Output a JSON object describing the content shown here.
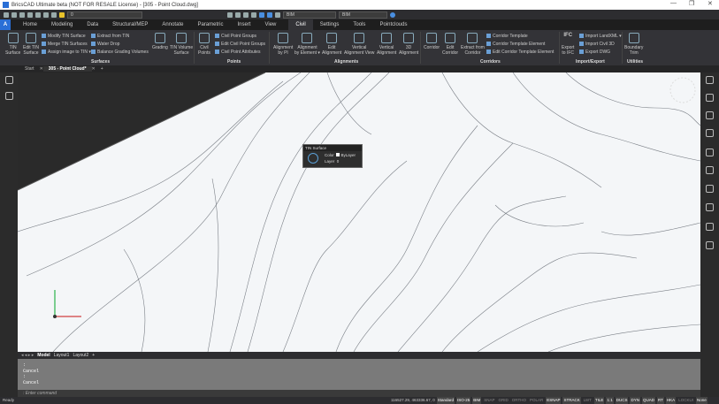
{
  "window": {
    "title": "BricsCAD Ultimate beta (NOT FOR RESALE License) - [305 - Point Cloud.dwg]",
    "min": "—",
    "max": "❐",
    "close": "✕"
  },
  "qat": {
    "layer": "0",
    "workspace": "BIM",
    "visual": "BIM"
  },
  "tabs": [
    "Home",
    "Modeling",
    "Data",
    "Structural/MEP",
    "Annotate",
    "Parametric",
    "Insert",
    "View",
    "Civil",
    "Settings",
    "Tools",
    "Pointclouds"
  ],
  "app_button": "A",
  "ribbon": {
    "big": [
      {
        "l1": "TIN",
        "l2": "Surface"
      },
      {
        "l1": "Edit TIN",
        "l2": "Surface"
      },
      {
        "l1": "Grading",
        "l2": ""
      },
      {
        "l1": "TIN Volume",
        "l2": "Surface"
      },
      {
        "l1": "Civil",
        "l2": "Points"
      },
      {
        "l1": "Alignment",
        "l2": "by PI"
      },
      {
        "l1": "Alignment",
        "l2": "by Element ▾"
      },
      {
        "l1": "Edit",
        "l2": "Alignment"
      },
      {
        "l1": "Vertical",
        "l2": "Alignment View"
      },
      {
        "l1": "Vertical",
        "l2": "Alignment"
      },
      {
        "l1": "3D",
        "l2": "Alignment"
      },
      {
        "l1": "Corridor",
        "l2": ""
      },
      {
        "l1": "Edit",
        "l2": "Corridor"
      },
      {
        "l1": "Extract from",
        "l2": "Corridor"
      },
      {
        "l1": "Export",
        "l2": "to IFC"
      },
      {
        "l1": "Boundary",
        "l2": "Trim"
      }
    ],
    "small": [
      "Modify TIN Surface",
      "Merge TIN Surfaces",
      "Assign image to TIN ▾",
      "Extract from TIN",
      "Water Drop",
      "Balance Grading Volumes",
      "Civil Point Groups",
      "Edit Civil Point Groups",
      "Civil Point Attributes",
      "Corridor Template",
      "Corridor Template Element",
      "Edit Corridor Template Element",
      "Import LandXML ▾",
      "Import Civil 3D",
      "Export DWG"
    ],
    "groups": [
      "Surfaces",
      "Points",
      "Alignments",
      "Corridors",
      "Import/Export",
      "Utilities"
    ],
    "ifc": "IFC"
  },
  "doc_tabs": [
    "Start",
    "305 - Point Cloud*",
    "+"
  ],
  "tooltip": {
    "title": "TIN Surface",
    "color_label": "Color",
    "color_value": "ByLayer",
    "layer_label": "Layer",
    "layer_value": "0"
  },
  "layout_tabs": [
    "Model",
    "Layout1",
    "Layout2",
    "+"
  ],
  "command": {
    "history": [
      ":",
      "Cancel",
      ":",
      "Cancel"
    ],
    "placeholder": ": Enter command"
  },
  "status": {
    "ready": "Ready",
    "coords": "116527.29, 463336.67, 0",
    "items": [
      "Standard",
      "ISO-25",
      "BIM",
      "SNAP",
      "GRID",
      "ORTHO",
      "POLAR",
      "ESNAP",
      "STRACK",
      "LWT",
      "TILE",
      "1:1",
      "DUCS",
      "DYN",
      "QUAD",
      "RT",
      "HKA",
      "LOCKUI",
      "None"
    ],
    "on": [
      0,
      1,
      2,
      7,
      8,
      10,
      11,
      12,
      13,
      14,
      15,
      16,
      18
    ]
  }
}
